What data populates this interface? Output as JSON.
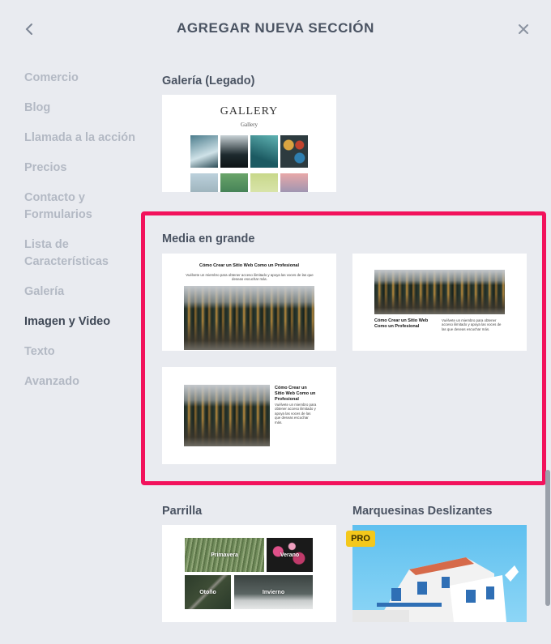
{
  "header": {
    "title": "AGREGAR NUEVA SECCIÓN"
  },
  "sidebar": {
    "items": [
      {
        "label": "Comercio",
        "active": false
      },
      {
        "label": "Blog",
        "active": false
      },
      {
        "label": "Llamada a la acción",
        "active": false
      },
      {
        "label": "Precios",
        "active": false
      },
      {
        "label": "Contacto y\nFormularios",
        "active": false
      },
      {
        "label": "Lista de\nCaracterísticas",
        "active": false
      },
      {
        "label": "Galería",
        "active": false
      },
      {
        "label": "Imagen y Video",
        "active": true
      },
      {
        "label": "Texto",
        "active": false
      },
      {
        "label": "Avanzado",
        "active": false
      }
    ]
  },
  "sections": {
    "galeria_legado": {
      "title": "Galería (Legado)",
      "thumb_title": "GALLERY",
      "thumb_subtitle": "Gallery"
    },
    "media_grande": {
      "title": "Media en grande",
      "card1": {
        "heading": "Cómo Crear un Sitio Web Como un Profesional",
        "text": "Vuélvete un miembro para obtener acceso ilimitado y apoya las voces de las que deseas escuchar más."
      },
      "card2": {
        "heading": "Cómo Crear un Sitio Web Como un Profesional",
        "text": "Vuélvete un miembro para obtener acceso ilimitado y apoya las voces de las que deseas escuchar más."
      },
      "card3": {
        "heading": "Cómo Crear un Sitio Web Como un Profesional",
        "text": "Vuélvete un miembro para obtener acceso ilimitado y apoya las voces de las que deseas escuchar más."
      }
    },
    "parrilla": {
      "title": "Parrilla",
      "cells": [
        "Primavera",
        "Verano",
        "Otoño",
        "Invierno"
      ]
    },
    "marquesinas": {
      "title": "Marquesinas Deslizantes",
      "badge": "PRO"
    }
  },
  "colors": {
    "background": "#e9ebf0",
    "highlight": "#f2125c",
    "pro_badge": "#f4c81b",
    "active_nav": "#3f4856",
    "inactive_nav": "#b3b9c4"
  }
}
